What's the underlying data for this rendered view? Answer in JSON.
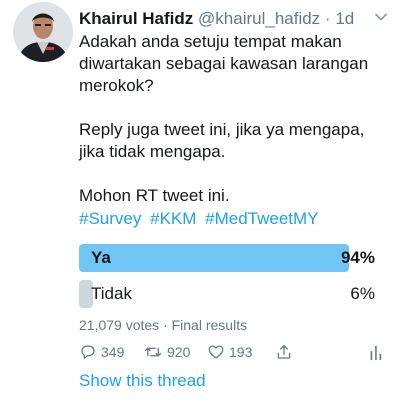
{
  "tweet": {
    "author_name": "Khairul Hafidz",
    "handle": "@khairul_hafidz",
    "separator": "·",
    "time": "1d",
    "body": {
      "line1": "Adakah anda setuju tempat makan diwartakan sebagai kawasan larangan merokok?",
      "line2": "Reply juga tweet ini, jika ya mengapa, jika tidak mengapa.",
      "line3": "Mohon RT tweet ini."
    },
    "hashtags": [
      "#Survey",
      "#KKM",
      "#MedTweetMY"
    ]
  },
  "poll": {
    "options": [
      {
        "label": "Ya",
        "percent_text": "94%",
        "percent": 94,
        "winner": true
      },
      {
        "label": "Tidak",
        "percent_text": "6%",
        "percent": 6,
        "winner": false
      }
    ],
    "summary": "21,079 votes · Final results"
  },
  "actions": {
    "reply_count": "349",
    "retweet_count": "920",
    "like_count": "193"
  },
  "show_thread": "Show this thread",
  "colors": {
    "link": "#1da1f2",
    "winner_bar": "#71c5f4",
    "loser_bar": "#ccd6dd",
    "secondary_text": "#657786"
  }
}
